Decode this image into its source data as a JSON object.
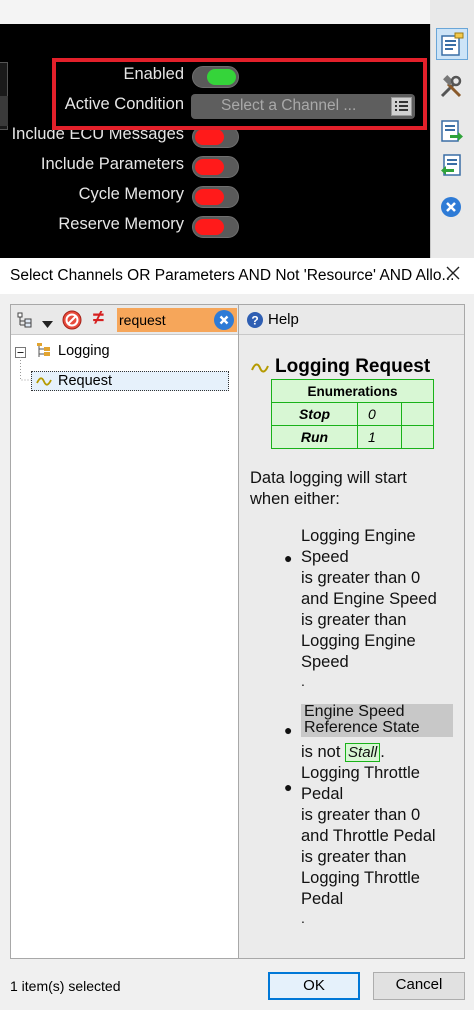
{
  "properties": {
    "enabled_label": "Enabled",
    "active_condition_label": "Active Condition",
    "active_condition_placeholder": "Select a Channel ...",
    "include_ecu_label": "Include ECU Messages",
    "include_params_label": "Include Parameters",
    "cycle_memory_label": "Cycle Memory",
    "reserve_memory_label": "Reserve Memory"
  },
  "toggles": {
    "enabled": "on",
    "include_ecu": "off",
    "include_params": "off",
    "cycle_memory": "off",
    "reserve_memory": "off"
  },
  "dialog": {
    "title": "Select Channels OR Parameters AND Not 'Resource' AND Allo...",
    "search_value": "request",
    "help_button": "Help",
    "status": "1 item(s) selected",
    "ok": "OK",
    "cancel": "Cancel"
  },
  "tree": {
    "root": "Logging",
    "child": "Request"
  },
  "help": {
    "heading": "Logging Request",
    "enum_header": "Enumerations",
    "enums": [
      {
        "label": "Stop",
        "value": "0"
      },
      {
        "label": "Run",
        "value": "1"
      }
    ],
    "intro_line1": "Data logging will start",
    "intro_line2": "when either:",
    "bullet1_lines": [
      "Logging Engine",
      "Speed",
      "is greater than 0",
      "and Engine Speed",
      "is greater than",
      "Logging Engine",
      "Speed",
      "."
    ],
    "ref_line1": "Engine Speed",
    "ref_line2": "Reference State",
    "is_not": "is not",
    "stall": "Stall",
    "dot": ".",
    "bullet3_lines": [
      "Logging Throttle",
      "Pedal",
      "is greater than 0",
      "and Throttle Pedal",
      "is greater than",
      "Logging Throttle",
      "Pedal",
      "."
    ]
  },
  "colors": {
    "highlight": "#e3202a",
    "toggle_on": "#35d43a",
    "toggle_off": "#ff1a1a",
    "search_bg": "#f6a65a",
    "enum_border": "#19b219",
    "enum_fill": "#d8f7d4"
  }
}
